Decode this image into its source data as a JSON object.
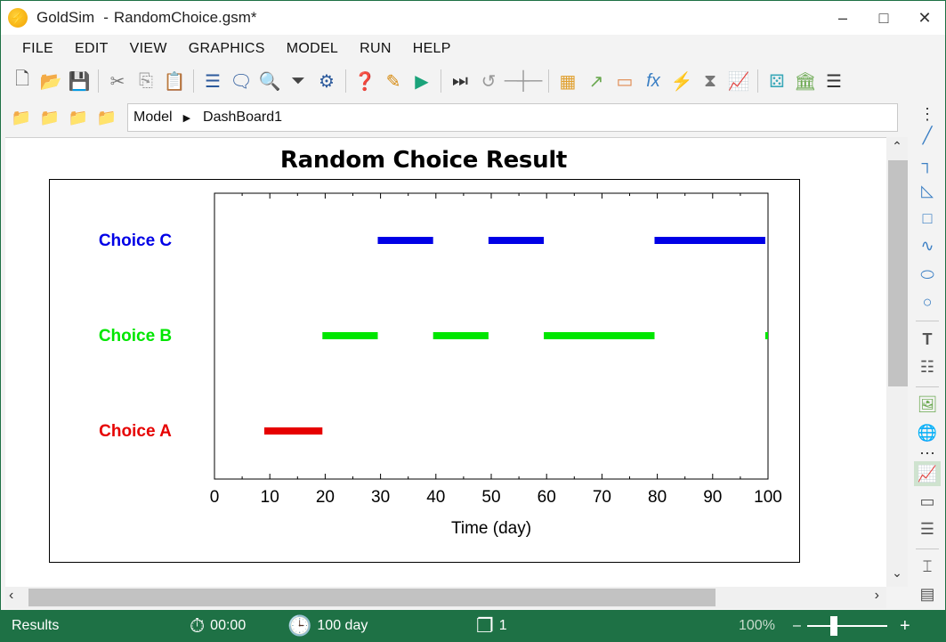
{
  "window": {
    "app_name": "GoldSim",
    "separator": "-",
    "document": "RandomChoice.gsm*"
  },
  "menu": [
    "FILE",
    "EDIT",
    "VIEW",
    "GRAPHICS",
    "MODEL",
    "RUN",
    "HELP"
  ],
  "breadcrumb": {
    "root": "Model",
    "current": "DashBoard1"
  },
  "chart_data": {
    "type": "line",
    "title": "Random Choice Result",
    "xlabel": "Time (day)",
    "ylabel": "",
    "xlim": [
      0,
      100
    ],
    "x_ticks": [
      0,
      10,
      20,
      30,
      40,
      50,
      60,
      70,
      80,
      90,
      100
    ],
    "grid": false,
    "categories": [
      "Choice A",
      "Choice B",
      "Choice C"
    ],
    "series": [
      {
        "name": "Choice A",
        "color": "#e60000",
        "segments": [
          [
            9,
            19.5
          ]
        ]
      },
      {
        "name": "Choice B",
        "color": "#00e600",
        "segments": [
          [
            19.5,
            29.5
          ],
          [
            39.5,
            49.5
          ],
          [
            59.5,
            79.5
          ],
          [
            99.5,
            100
          ]
        ]
      },
      {
        "name": "Choice C",
        "color": "#0000e6",
        "segments": [
          [
            29.5,
            39.5
          ],
          [
            49.5,
            59.5
          ],
          [
            79.5,
            99.5
          ]
        ]
      }
    ]
  },
  "status": {
    "mode": "Results",
    "clock_time": "00:00",
    "sim_time": "100 day",
    "realization": "1",
    "zoom": "100%",
    "zoom_minus": "–",
    "zoom_plus": "+"
  }
}
